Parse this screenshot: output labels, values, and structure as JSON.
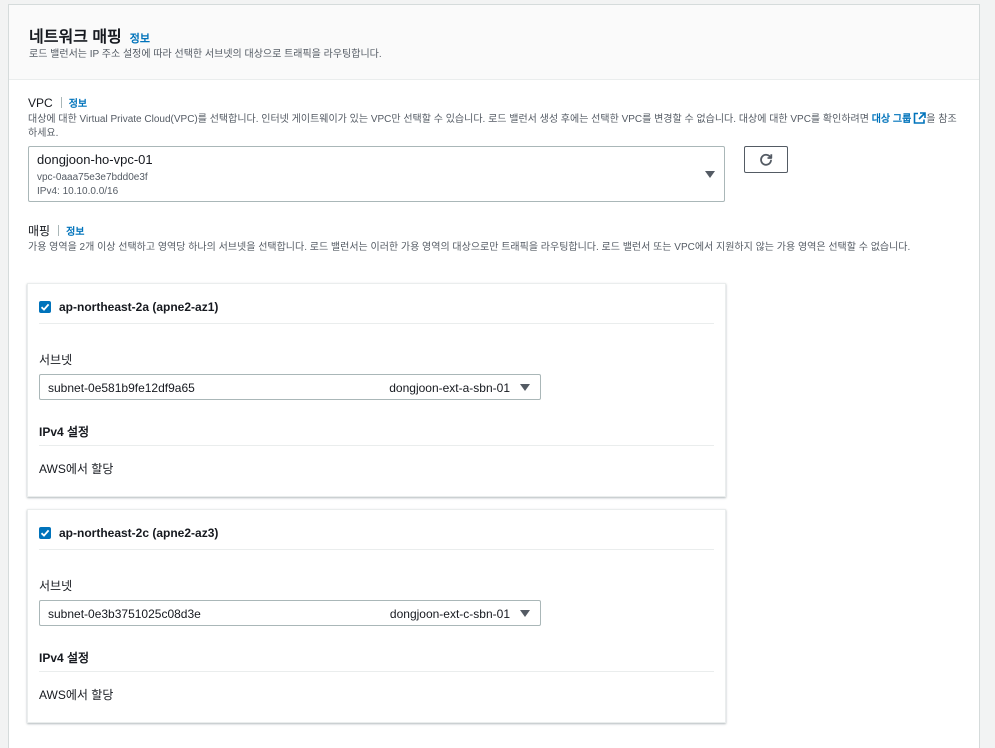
{
  "section": {
    "title": "네트워크 매핑",
    "info": "정보",
    "description": "로드 밸런서는 IP 주소 설정에 따라 선택한 서브넷의 대상으로 트래픽을 라우팅합니다."
  },
  "vpc": {
    "label": "VPC",
    "info": "정보",
    "desc_part1": "대상에 대한 Virtual Private Cloud(VPC)를 선택합니다. 인터넷 게이트웨이가 있는 VPC만 선택할 수 있습니다. 로드 밸런서 생성 후에는 선택한 VPC를 변경할 수 없습니다. 대상에 대한 VPC를 확인하려면 ",
    "desc_link": "대상 그룹",
    "desc_part2": "을 참조하세요.",
    "selected_name": "dongjoon-ho-vpc-01",
    "selected_id": "vpc-0aaa75e3e7bdd0e3f",
    "selected_cidr": "IPv4: 10.10.0.0/16"
  },
  "mapping": {
    "label": "매핑",
    "info": "정보",
    "description": "가용 영역을 2개 이상 선택하고 영역당 하나의 서브넷을 선택합니다. 로드 밸런서는 이러한 가용 영역의 대상으로만 트래픽을 라우팅합니다. 로드 밸런서 또는 VPC에서 지원하지 않는 가용 영역은 선택할 수 없습니다.",
    "zones": [
      {
        "name": "ap-northeast-2a (apne2-az1)",
        "subnet_label": "서브넷",
        "subnet_id": "subnet-0e581b9fe12df9a65",
        "subnet_name": "dongjoon-ext-a-sbn-01",
        "ipv4_title": "IPv4 설정",
        "ipv4_value": "AWS에서 할당"
      },
      {
        "name": "ap-northeast-2c (apne2-az3)",
        "subnet_label": "서브넷",
        "subnet_id": "subnet-0e3b3751025c08d3e",
        "subnet_name": "dongjoon-ext-c-sbn-01",
        "ipv4_title": "IPv4 설정",
        "ipv4_value": "AWS에서 할당"
      }
    ]
  },
  "colors": {
    "link": "#0073bb",
    "checkbox": "#0073bb",
    "text": "#16191f",
    "muted": "#545b64",
    "border": "#aab7b8"
  }
}
